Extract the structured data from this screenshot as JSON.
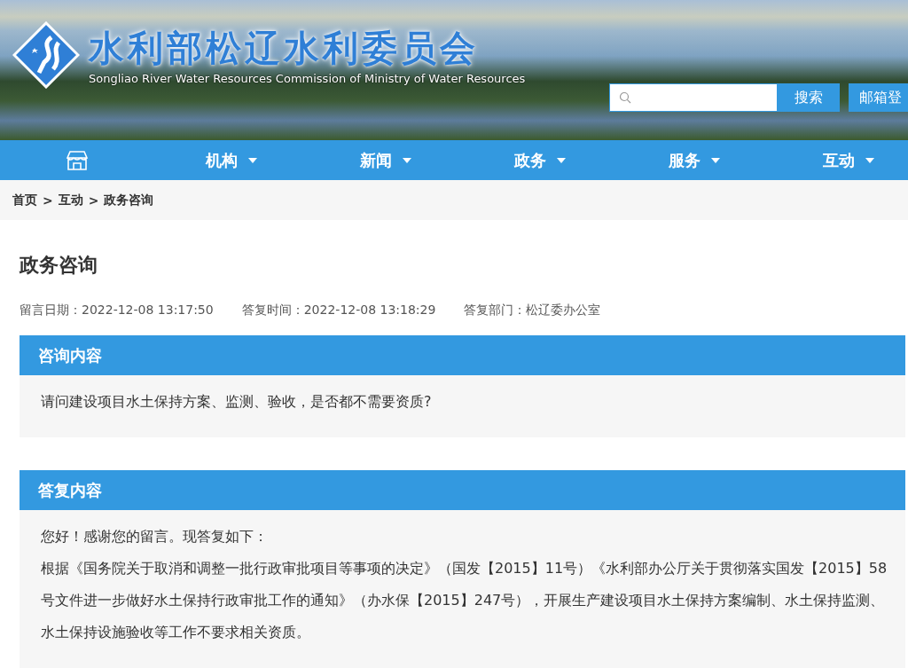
{
  "header": {
    "title": "水利部松辽水利委员会",
    "subtitle": "Songliao River Water Resources Commission of Ministry of Water Resources",
    "search_button": "搜索",
    "mail_button": "邮箱登"
  },
  "nav": [
    {
      "kind": "home"
    },
    {
      "kind": "menu",
      "label": "机构"
    },
    {
      "kind": "menu",
      "label": "新闻"
    },
    {
      "kind": "menu",
      "label": "政务"
    },
    {
      "kind": "menu",
      "label": "服务"
    },
    {
      "kind": "menu",
      "label": "互动"
    }
  ],
  "breadcrumb": {
    "separator": ">",
    "items": [
      "首页",
      "互动",
      "政务咨询"
    ]
  },
  "page_title": "政务咨询",
  "meta": [
    "留言日期：2022-12-08 13:17:50",
    "答复时间：2022-12-08 13:18:29",
    "答复部门：松辽委办公室"
  ],
  "sections": [
    {
      "heading": "咨询内容",
      "paragraphs": [
        "请问建设项目水土保持方案、监测、验收，是否都不需要资质?"
      ]
    },
    {
      "heading": "答复内容",
      "paragraphs": [
        "您好！感谢您的留言。现答复如下：",
        "根据《国务院关于取消和调整一批行政审批项目等事项的决定》（国发【2015】11号）《水利部办公厅关于贯彻落实国发【2015】58号文件进一步做好水土保持行政审批工作的通知》（办水保【2015】247号），开展生产建设项目水土保持方案编制、水土保持监测、水土保持设施验收等工作不要求相关资质。"
      ]
    }
  ]
}
